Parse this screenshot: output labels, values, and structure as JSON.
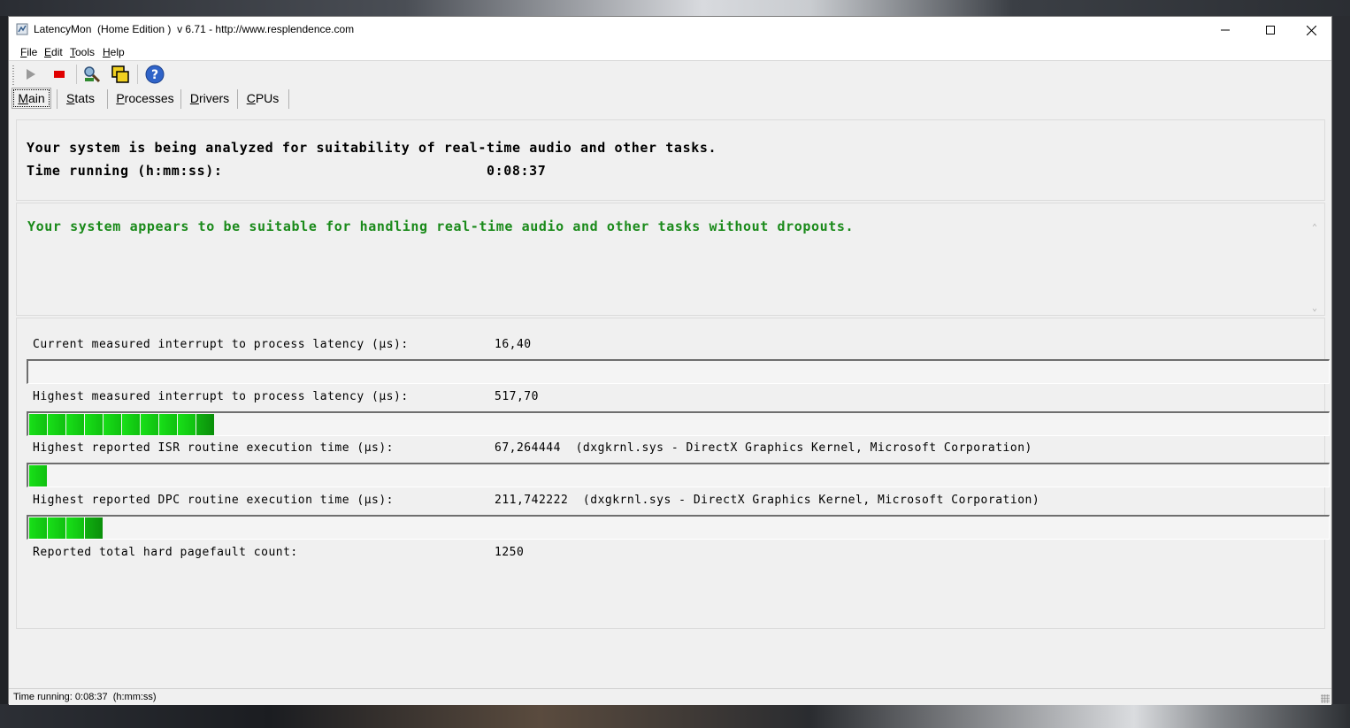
{
  "window": {
    "title": "LatencyMon  (Home Edition )  v 6.71 - http://www.resplendence.com"
  },
  "menu": [
    {
      "label": "File"
    },
    {
      "label": "Edit"
    },
    {
      "label": "Tools"
    },
    {
      "label": "Help"
    }
  ],
  "toolbar": {
    "icons": [
      "play-icon",
      "stop-icon",
      "analyze-icon",
      "windows-icon",
      "help-icon"
    ]
  },
  "tabs": [
    {
      "label": "Main",
      "active": true
    },
    {
      "label": "Stats"
    },
    {
      "label": "Processes"
    },
    {
      "label": "Drivers"
    },
    {
      "label": "CPUs"
    }
  ],
  "header": {
    "line1": "Your system is being analyzed for suitability of real-time audio and other tasks.",
    "time_label": "Time running (h:mm:ss):",
    "time_value": "0:08:37"
  },
  "status_message": "Your system appears to be suitable for handling real-time audio and other tasks without dropouts.",
  "status_color": "#1a8a1a",
  "metrics": [
    {
      "label": "Current measured interrupt to process latency (µs):",
      "value": "16,40",
      "segments": 0
    },
    {
      "label": "Highest measured interrupt to process latency (µs):",
      "value": "517,70",
      "segments": 10
    },
    {
      "label": "Highest reported ISR routine execution time (µs):",
      "value": "67,264444  (dxgkrnl.sys - DirectX Graphics Kernel, Microsoft Corporation)",
      "segments": 1
    },
    {
      "label": "Highest reported DPC routine execution time (µs):",
      "value": "211,742222  (dxgkrnl.sys - DirectX Graphics Kernel, Microsoft Corporation)",
      "segments": 4
    },
    {
      "label": "Reported total hard pagefault count:",
      "value": "1250"
    }
  ],
  "statusbar": {
    "text": "Time running: 0:08:37  (h:mm:ss)"
  }
}
